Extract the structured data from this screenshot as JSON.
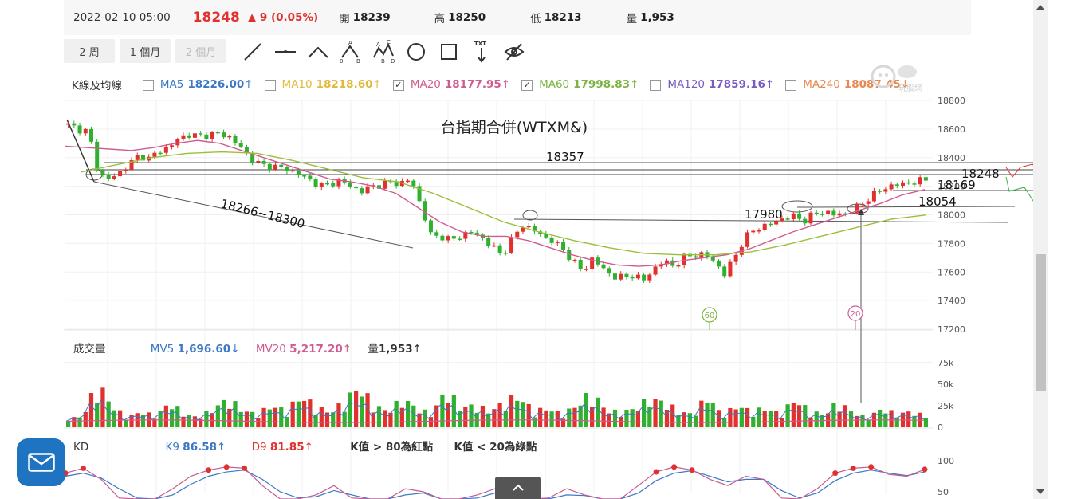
{
  "quote": {
    "date": "2022-02-10 05:00",
    "price": "18248",
    "change": "▲ 9 (0.05%)",
    "open_label": "開",
    "open": "18239",
    "high_label": "高",
    "high": "18250",
    "low_label": "低",
    "low": "18213",
    "vol_label": "量",
    "vol": "1,953"
  },
  "toolbar": {
    "periods": [
      "2 周",
      "1 個月",
      "2 個月"
    ],
    "active_periods": [
      true,
      true,
      false
    ],
    "tools": [
      "trendline-icon",
      "horizontal-line-icon",
      "triangle-line-icon",
      "abc-wave-icon",
      "abcd-wave-icon",
      "circle-icon",
      "rectangle-icon",
      "text-icon",
      "hide-icon"
    ],
    "text_tool_label": "TXT"
  },
  "ma_legend": {
    "label": "K線及均線",
    "items": [
      {
        "name": "MA5",
        "value": "18226.00",
        "arrow": "↑",
        "checked": false,
        "color": "#3b78c6"
      },
      {
        "name": "MA10",
        "value": "18218.60",
        "arrow": "↑",
        "checked": false,
        "color": "#e2b93b"
      },
      {
        "name": "MA20",
        "value": "18177.95",
        "arrow": "↑",
        "checked": true,
        "color": "#d05b91"
      },
      {
        "name": "MA60",
        "value": "17998.83",
        "arrow": "↑",
        "checked": true,
        "color": "#7cb342"
      },
      {
        "name": "MA120",
        "value": "17859.16",
        "arrow": "↑",
        "checked": false,
        "color": "#7b5cc4"
      },
      {
        "name": "MA240",
        "value": "18087.45",
        "arrow": "↓",
        "checked": false,
        "color": "#e8874f"
      }
    ]
  },
  "volume_legend": {
    "label": "成交量",
    "mv5_name": "MV5",
    "mv5": "1,696.60",
    "mv5_arrow": "↓",
    "mv20_name": "MV20",
    "mv20": "5,217.20",
    "mv20_arrow": "↑",
    "vol_name": "量",
    "vol": "1,953",
    "vol_arrow": "↑"
  },
  "kd_legend": {
    "label": "KD",
    "k_name": "K9",
    "k": "86.58",
    "k_arrow": "↑",
    "d_name": "D9",
    "d": "81.85",
    "d_arrow": "↑",
    "note1": "K值 > 80為紅點",
    "note2": "K值 < 20為綠點"
  },
  "watermark": "玩股網",
  "colors": {
    "up": "#e0312f",
    "down": "#2fb12f",
    "ma20": "#d05b91",
    "ma60": "#9bbf3a",
    "mv5": "#3b78c6",
    "mv20": "#d05b91",
    "k": "#e0312f",
    "d": "#3b78c6"
  },
  "chart_data": {
    "type": "candlestick",
    "title": "台指期合併(WTXM&)",
    "price_axis": {
      "ticks": [
        18800,
        18600,
        18400,
        18200,
        18000,
        17800,
        17600,
        17400,
        17200
      ],
      "range": [
        17200,
        18800
      ]
    },
    "volume_axis": {
      "tick_labels": [
        "75k",
        "50k",
        "25k",
        "0"
      ],
      "ticks": [
        75000,
        50000,
        25000,
        0
      ]
    },
    "kd_axis": {
      "ticks": [
        100,
        50
      ]
    },
    "close_path": [
      18630,
      18600,
      18580,
      18290,
      18250,
      18290,
      18350,
      18420,
      18390,
      18450,
      18470,
      18540,
      18560,
      18550,
      18560,
      18570,
      18540,
      18480,
      18400,
      18350,
      18340,
      18330,
      18310,
      18280,
      18240,
      18200,
      18220,
      18240,
      18200,
      18160,
      18200,
      18210,
      18230,
      18220,
      18250,
      18050,
      17850,
      17850,
      17820,
      17860,
      17880,
      17840,
      17780,
      17720,
      17830,
      17930,
      17900,
      17850,
      17820,
      17760,
      17680,
      17600,
      17700,
      17620,
      17570,
      17560,
      17580,
      17540,
      17620,
      17680,
      17640,
      17700,
      17720,
      17720,
      17680,
      17580,
      17700,
      17830,
      17900,
      17920,
      17950,
      17980,
      17990,
      17960,
      18010,
      18020,
      18000,
      18010,
      18040,
      18100,
      18150,
      18190,
      18210,
      18220,
      18230,
      18248
    ],
    "ma20_path": [
      18480,
      18470,
      18460,
      18450,
      18470,
      18500,
      18520,
      18500,
      18450,
      18400,
      18350,
      18300,
      18250,
      18230,
      18200,
      18150,
      18050,
      17950,
      17880,
      17850,
      17850,
      17820,
      17770,
      17720,
      17680,
      17650,
      17640,
      17650,
      17680,
      17700,
      17720,
      17760,
      17820,
      17880,
      17930,
      17980,
      18030,
      18080,
      18140,
      18177
    ],
    "ma60_path": [
      18300,
      18350,
      18400,
      18430,
      18440,
      18430,
      18380,
      18320,
      18260,
      18230,
      18150,
      18050,
      17950,
      17880,
      17820,
      17770,
      17730,
      17720,
      17720,
      17740,
      17790,
      17850,
      17910,
      17970,
      17999
    ],
    "volume_bars_k": [
      8,
      12,
      65,
      30,
      10,
      20,
      12,
      35,
      15,
      10,
      25,
      40,
      22,
      15,
      30,
      20,
      45,
      28,
      18,
      35,
      60,
      30,
      20,
      40,
      25,
      15,
      55,
      25,
      30,
      20,
      35,
      45,
      20,
      25,
      15,
      30,
      50,
      22,
      18,
      25,
      40,
      35,
      20,
      15,
      45,
      12,
      30,
      20,
      25,
      15,
      40,
      20,
      15,
      35,
      18,
      10,
      25,
      15,
      20,
      12
    ],
    "kd_k_path": [
      80,
      88,
      70,
      40,
      25,
      30,
      55,
      75,
      85,
      90,
      88,
      60,
      35,
      30,
      45,
      60,
      40,
      20,
      35,
      55,
      50,
      30,
      25,
      45,
      55,
      30,
      20,
      40,
      55,
      45,
      28,
      35,
      60,
      82,
      90,
      85,
      70,
      60,
      75,
      70,
      40,
      30,
      55,
      80,
      88,
      90,
      78,
      75,
      86
    ],
    "kd_d_path": [
      75,
      80,
      72,
      55,
      40,
      35,
      45,
      62,
      75,
      82,
      85,
      70,
      50,
      40,
      42,
      52,
      45,
      32,
      35,
      45,
      48,
      38,
      32,
      40,
      48,
      38,
      28,
      35,
      45,
      44,
      35,
      35,
      48,
      68,
      80,
      84,
      75,
      66,
      70,
      70,
      52,
      40,
      48,
      68,
      80,
      85,
      80,
      76,
      82
    ],
    "annotations": [
      {
        "text": "18357"
      },
      {
        "text": "18266~18300"
      },
      {
        "text": "17980"
      },
      {
        "text": "18248"
      },
      {
        "text": "18169"
      },
      {
        "text": "18054"
      }
    ],
    "markers": [
      {
        "label": "60"
      },
      {
        "label": "20"
      }
    ]
  }
}
